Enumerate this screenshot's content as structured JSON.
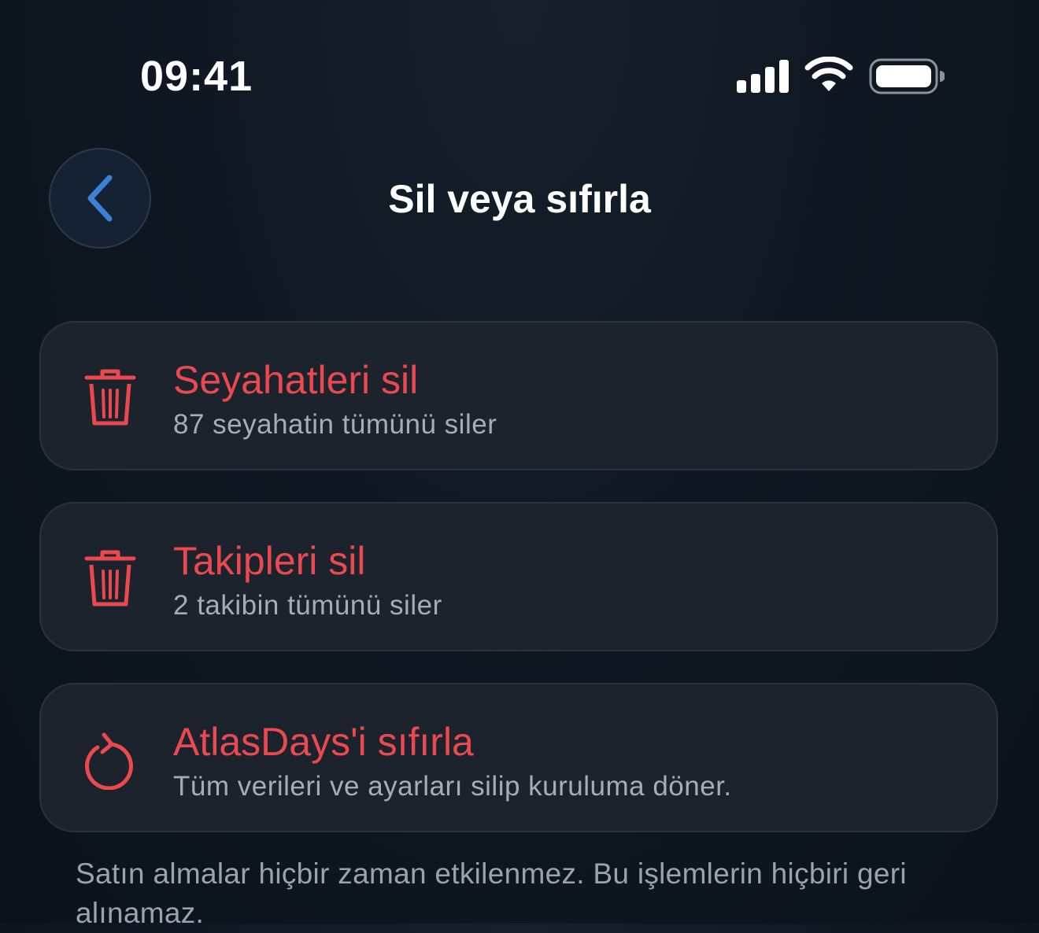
{
  "status_bar": {
    "time": "09:41",
    "icons": [
      "cellular-signal-icon",
      "wifi-icon",
      "battery-icon"
    ]
  },
  "header": {
    "back_icon": "chevron-left-icon",
    "title": "Sil veya sıfırla"
  },
  "actions": [
    {
      "icon": "trash-icon",
      "title": "Seyahatleri sil",
      "subtitle": "87 seyahatin tümünü siler"
    },
    {
      "icon": "trash-icon",
      "title": "Takipleri sil",
      "subtitle": "2 takibin tümünü siler"
    },
    {
      "icon": "reset-icon",
      "title": "AtlasDays'i sıfırla",
      "subtitle": "Tüm verileri ve ayarları silip kuruluma döner."
    }
  ],
  "footer_note": "Satın almalar hiçbir zaman etkilenmez. Bu işlemlerin hiçbiri geri alınamaz.",
  "colors": {
    "destructive": "#ea4a4f",
    "accent": "#3b82d6",
    "card_background": "#1d232c",
    "page_background": "#0f1822"
  }
}
